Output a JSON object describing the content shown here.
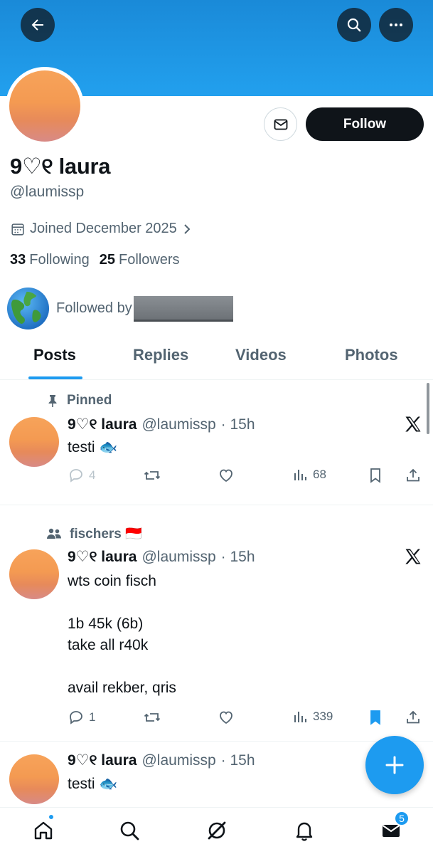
{
  "profile": {
    "display_name": "9♡୧ laura",
    "handle": "@laumissp",
    "joined": "Joined December 2025",
    "following_count": "33",
    "following_label": "Following",
    "followers_count": "25",
    "followers_label": "Followers",
    "followed_by_label": "Followed by"
  },
  "header": {
    "follow_label": "Follow",
    "back_icon": "arrow-left-icon",
    "search_icon": "search-icon",
    "more_icon": "more-icon",
    "banner_color": "#1d9bf0"
  },
  "tabs": [
    {
      "label": "Posts",
      "active": true
    },
    {
      "label": "Replies",
      "active": false
    },
    {
      "label": "Videos",
      "active": false
    },
    {
      "label": "Photos",
      "active": false
    }
  ],
  "posts": [
    {
      "context": "Pinned",
      "name": "9♡୧ laura",
      "handle": "@laumissp",
      "time": "· 15h",
      "text": "testi 🐟",
      "replies": "4",
      "views": "68",
      "bookmarked": false
    },
    {
      "context": "fischers 🇮🇩",
      "name": "9♡୧ laura",
      "handle": "@laumissp",
      "time": "· 15h",
      "text": "wts coin fisch\n\n1b 45k (6b)\ntake all r40k\n\navail rekber, qris",
      "replies": "1",
      "views": "339",
      "bookmarked": true
    },
    {
      "name": "9♡୧ laura",
      "handle": "@laumissp",
      "time": "· 15h",
      "text": "testi 🐟"
    }
  ],
  "nav": {
    "messages_badge": "5",
    "accent": "#1d9bf0"
  }
}
